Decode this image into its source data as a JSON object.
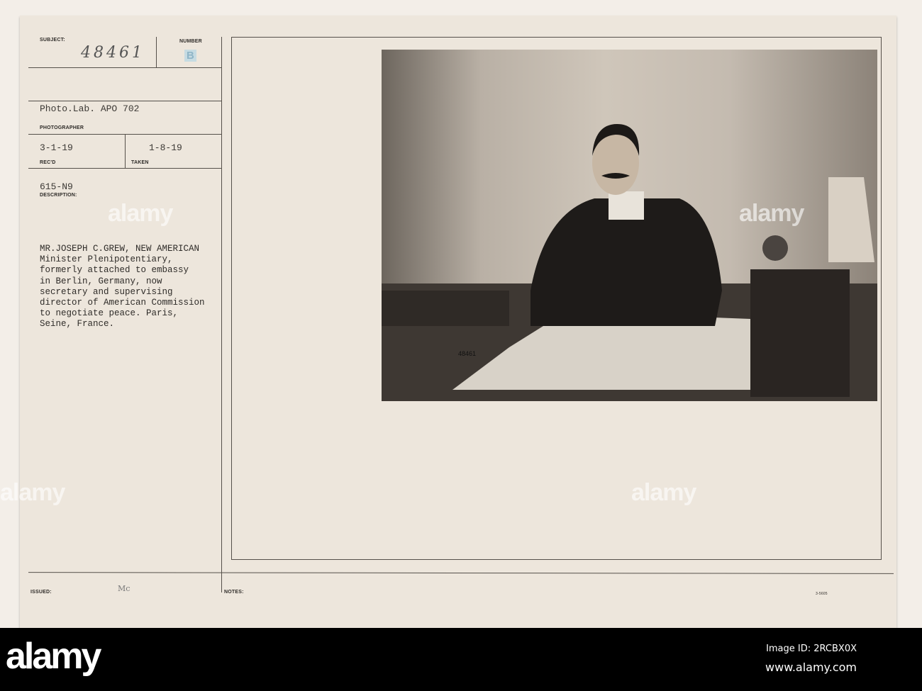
{
  "card": {
    "subject_label": "SUBJECT:",
    "subject_value": "48461",
    "number_label": "NUMBER",
    "number_stamp": "B",
    "photographer_value": "Photo.Lab. APO 702",
    "photographer_label": "PHOTOGRAPHER",
    "recd_value": "3-1-19",
    "recd_label": "REC'D",
    "taken_value": "1-8-19",
    "taken_label": "TAKEN",
    "description_code": "615-N9",
    "description_label": "DESCRIPTION:",
    "description_text": "MR.JOSEPH C.GREW, NEW AMERICAN\nMinister Plenipotentiary,\nformerly attached to embassy\nin Berlin, Germany, now\nsecretary and supervising\ndirector of American Commission\nto negotiate peace. Paris,\nSeine, France.",
    "issued_label": "ISSUED:",
    "issued_initials": "Mc",
    "notes_label": "NOTES:",
    "form_number": "3-5605",
    "photo_caption_number": "48461"
  },
  "watermark": "alamy",
  "footer": {
    "logo": "alamy",
    "image_id": "Image ID: 2RCBX0X",
    "url": "www.alamy.com"
  }
}
